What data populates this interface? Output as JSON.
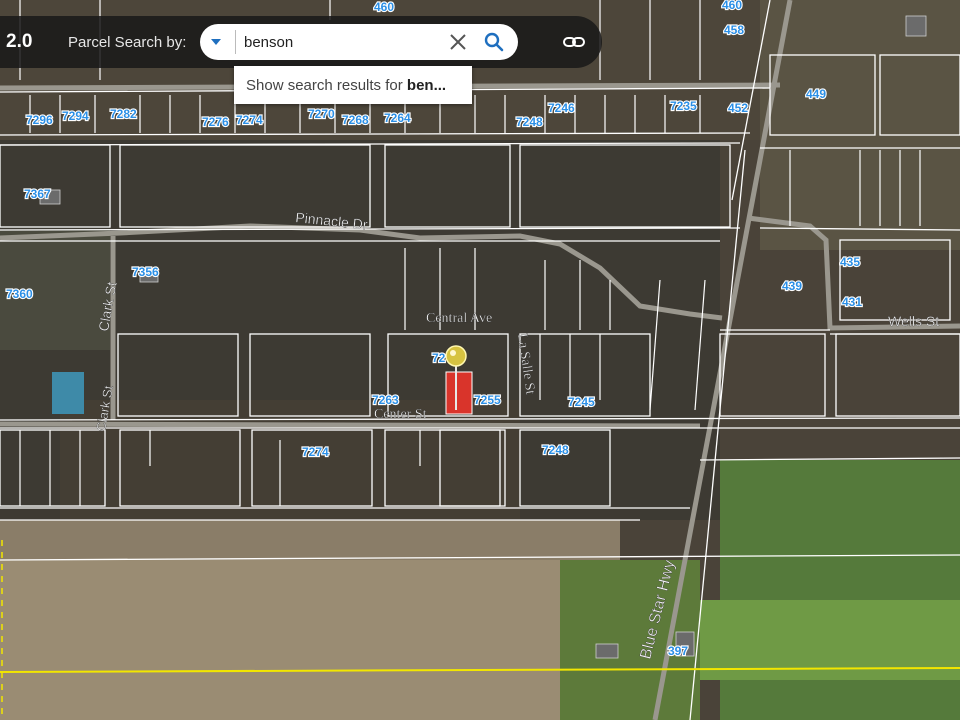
{
  "toolbar": {
    "version": "2.0",
    "search_by_label": "Parcel Search by:",
    "search_value": "benson",
    "suggestion_prefix": "Show search results for ",
    "suggestion_bold": "ben..."
  },
  "map": {
    "streets": [
      "Pinnacle Dr",
      "Clark St",
      "Clark St",
      "Central Ave",
      "La Salle St",
      "Center St",
      "Wells St",
      "Blue Star Hwy"
    ],
    "parcel_labels": [
      "460",
      "460",
      "458",
      "449",
      "7296",
      "7294",
      "7282",
      "7276",
      "7274",
      "7270",
      "7268",
      "7264",
      "7246",
      "7248",
      "7235",
      "452",
      "7367",
      "7356",
      "7360",
      "435",
      "439",
      "431",
      "72",
      "7263",
      "7255",
      "7245",
      "7274",
      "7248",
      "397"
    ],
    "colors": {
      "toolbar": "#181818",
      "label": "#2b8fe6",
      "parcel_line": "#ffffff",
      "selected_parcel": "#d9342b",
      "boundary": "#f2e600"
    }
  }
}
